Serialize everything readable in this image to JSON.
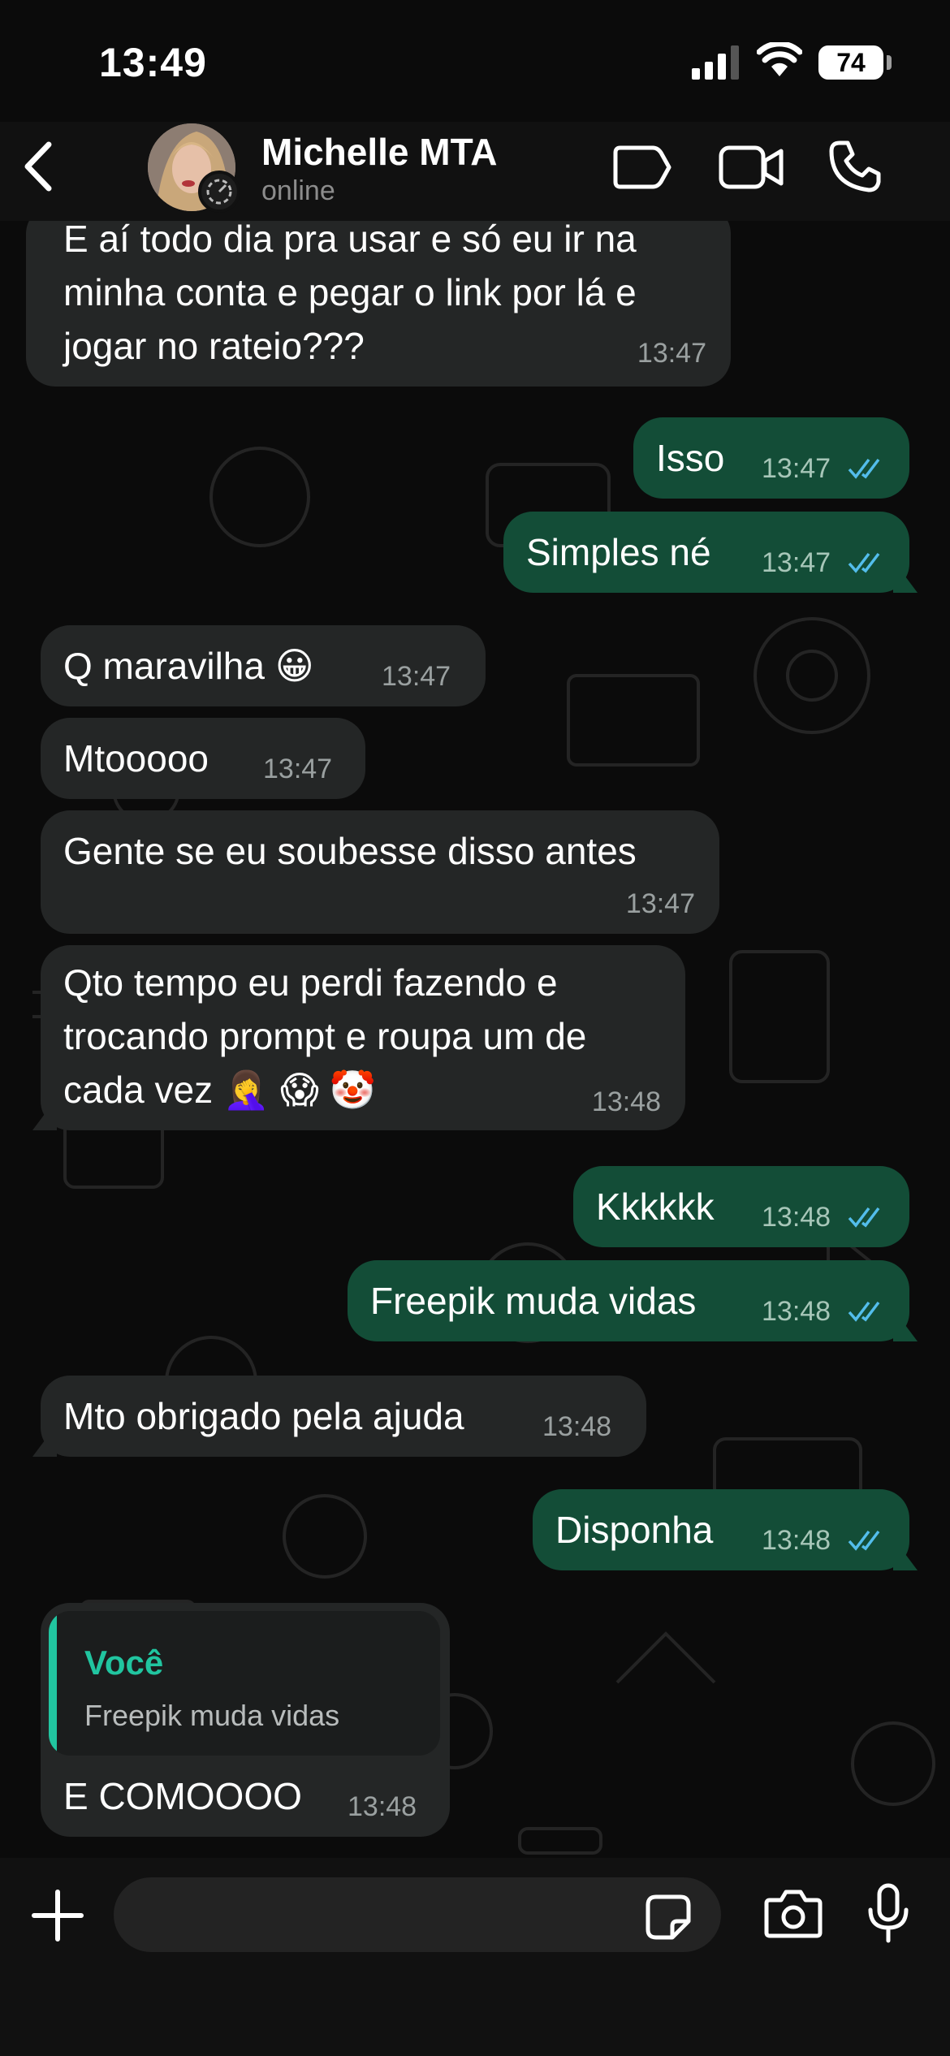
{
  "status_bar": {
    "time": "13:49",
    "battery": "74"
  },
  "header": {
    "contact_name": "Michelle MTA",
    "contact_status": "online"
  },
  "messages": [
    {
      "direction": "in",
      "lines": [
        "E aí todo dia pra usar e só eu ir na",
        "minha conta e pegar o link por lá e",
        "jogar no rateio???"
      ],
      "time": "13:47"
    },
    {
      "direction": "out",
      "text": "Isso",
      "time": "13:47",
      "read": true
    },
    {
      "direction": "out",
      "text": "Simples né",
      "time": "13:47",
      "read": true
    },
    {
      "direction": "in",
      "text": "Q maravilha 😀",
      "time": "13:47"
    },
    {
      "direction": "in",
      "text": "Mtooooo",
      "time": "13:47"
    },
    {
      "direction": "in",
      "text": "Gente se eu soubesse disso antes",
      "time": "13:47"
    },
    {
      "direction": "in",
      "lines": [
        "Qto tempo eu perdi fazendo e",
        "trocando prompt e roupa um de",
        "cada vez 🤦‍♀️ 😱 🤡"
      ],
      "time": "13:48"
    },
    {
      "direction": "out",
      "text": "Kkkkkk",
      "time": "13:48",
      "read": true
    },
    {
      "direction": "out",
      "text": "Freepik muda vidas",
      "time": "13:48",
      "read": true
    },
    {
      "direction": "in",
      "text": "Mto obrigado pela ajuda",
      "time": "13:48"
    },
    {
      "direction": "out",
      "text": "Disponha",
      "time": "13:48",
      "read": true
    },
    {
      "direction": "in",
      "quote_author": "Você",
      "quote_text": "Freepik muda vidas",
      "text": "E COMOOOO",
      "time": "13:48"
    }
  ],
  "colors": {
    "incoming_bubble": "#242626",
    "outgoing_bubble": "#134d37",
    "read_ticks": "#53bdeb",
    "quote_accent": "#21c5a0"
  },
  "icons": [
    "chevron-left-icon",
    "label-icon",
    "video-call-icon",
    "phone-icon",
    "plus-icon",
    "sticker-icon",
    "camera-icon",
    "microphone-icon"
  ]
}
